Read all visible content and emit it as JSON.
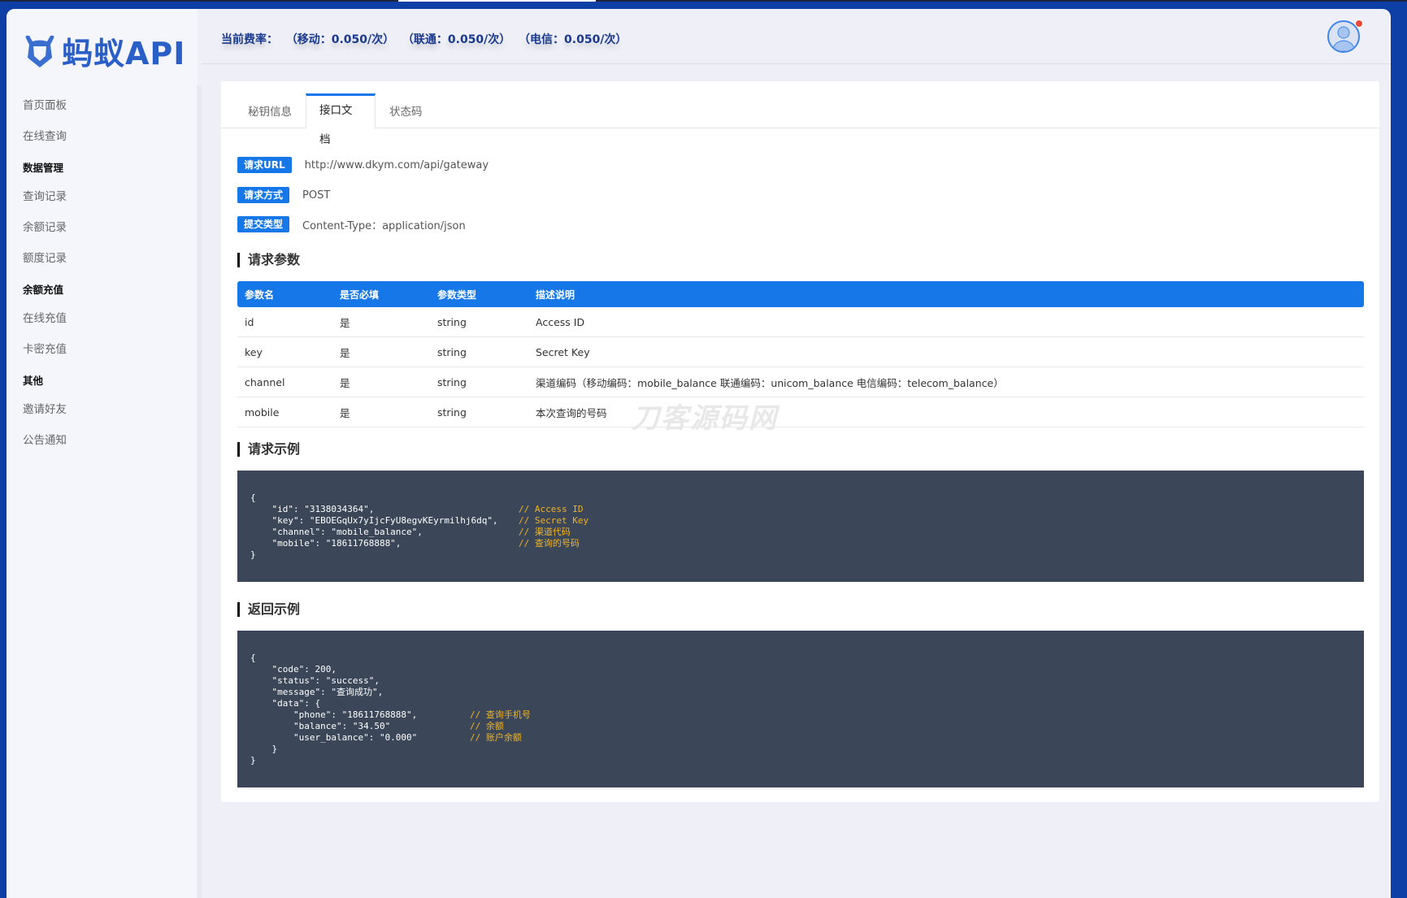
{
  "brand": {
    "logo_text": "蚂蚁API"
  },
  "header": {
    "rates": "当前费率：  （移动：0.050/次）  （联通：0.050/次）  （电信：0.050/次）",
    "has_notification": true
  },
  "sidebar": {
    "items": [
      {
        "label": "首页面板",
        "type": "item"
      },
      {
        "label": "在线查询",
        "type": "item"
      },
      {
        "label": "数据管理",
        "type": "group"
      },
      {
        "label": "查询记录",
        "type": "item"
      },
      {
        "label": "余额记录",
        "type": "item"
      },
      {
        "label": "额度记录",
        "type": "item"
      },
      {
        "label": "余额充值",
        "type": "group"
      },
      {
        "label": "在线充值",
        "type": "item"
      },
      {
        "label": "卡密充值",
        "type": "item"
      },
      {
        "label": "其他",
        "type": "group"
      },
      {
        "label": "邀请好友",
        "type": "item"
      },
      {
        "label": "公告通知",
        "type": "item"
      }
    ]
  },
  "tabs": [
    {
      "label": "秘钥信息",
      "active": false
    },
    {
      "label": "接口文档",
      "active": true
    },
    {
      "label": "状态码",
      "active": false
    }
  ],
  "info": [
    {
      "label": "请求URL",
      "value": "http://www.dkym.com/api/gateway"
    },
    {
      "label": "请求方式",
      "value": "POST"
    },
    {
      "label": "提交类型",
      "value": "Content-Type：application/json"
    }
  ],
  "sections": {
    "params": "请求参数",
    "request_example": "请求示例",
    "response_example": "返回示例"
  },
  "table": {
    "headers": [
      "参数名",
      "是否必填",
      "参数类型",
      "描述说明"
    ],
    "rows": [
      [
        "id",
        "是",
        "string",
        "Access ID"
      ],
      [
        "key",
        "是",
        "string",
        "Secret Key"
      ],
      [
        "channel",
        "是",
        "string",
        "渠道编码（移动编码：mobile_balance 联通编码：unicom_balance 电信编码：telecom_balance）"
      ],
      [
        "mobile",
        "是",
        "string",
        "本次查询的号码"
      ]
    ]
  },
  "request_code": [
    {
      "code": "{",
      "comment": ""
    },
    {
      "code": "    \"id\": \"3138034364\",",
      "comment": "// Access ID"
    },
    {
      "code": "    \"key\": \"EBOEGqUx7yIjcFyU8egvKEyrmilhj6dq\",",
      "comment": "// Secret Key"
    },
    {
      "code": "    \"channel\": \"mobile_balance\",",
      "comment": "// 渠道代码"
    },
    {
      "code": "    \"mobile\": \"18611768888\",",
      "comment": "// 查询的号码"
    },
    {
      "code": "}",
      "comment": ""
    }
  ],
  "response_code": [
    {
      "code": "{",
      "comment": ""
    },
    {
      "code": "    \"code\": 200,",
      "comment": ""
    },
    {
      "code": "    \"status\": \"success\",",
      "comment": ""
    },
    {
      "code": "    \"message\": \"查询成功\",",
      "comment": ""
    },
    {
      "code": "    \"data\": {",
      "comment": ""
    },
    {
      "code": "        \"phone\": \"18611768888\",",
      "comment": "// 查询手机号"
    },
    {
      "code": "        \"balance\": \"34.50\"",
      "comment": "// 余额"
    },
    {
      "code": "        \"user_balance\": \"0.000\"",
      "comment": "// 账户余额"
    },
    {
      "code": "    }",
      "comment": ""
    },
    {
      "code": "}",
      "comment": ""
    }
  ],
  "watermark": "刀客源码网",
  "colors": {
    "primary": "#1677e8",
    "frame": "#0d3fa6",
    "code_bg": "#3b4759",
    "comment": "#f0b323",
    "notification": "#e9483a"
  }
}
